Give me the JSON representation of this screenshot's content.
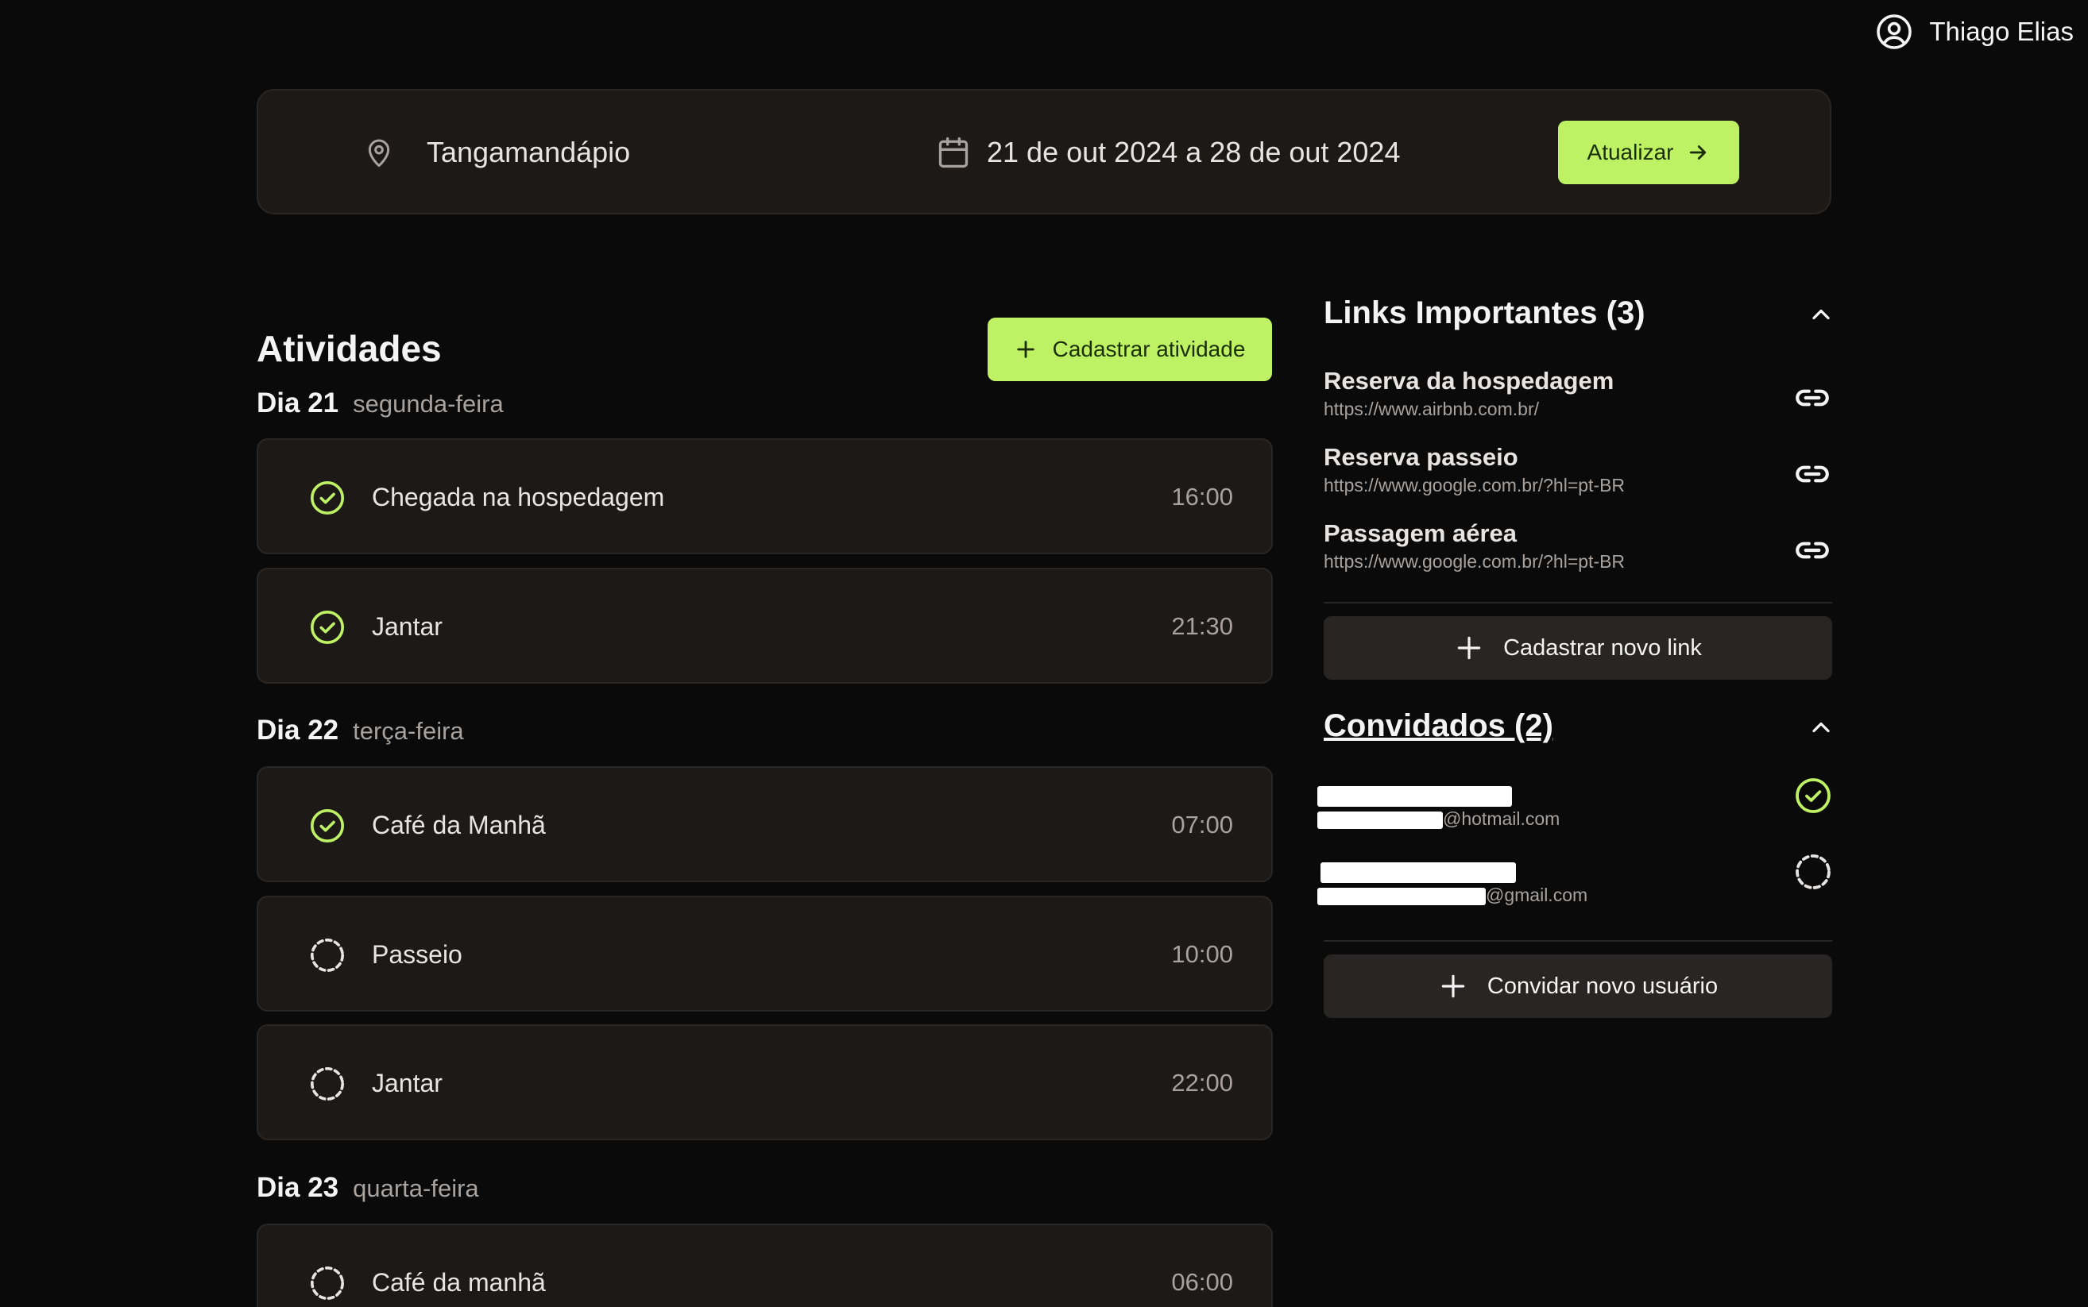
{
  "user": {
    "name": "Thiago Elias",
    "icon": "user-circle-icon"
  },
  "trip": {
    "location": "Tangamandápio",
    "dates": "21 de out 2024 a 28 de out 2024",
    "update_label": "Atualizar"
  },
  "activities": {
    "title": "Atividades",
    "add_label": "Cadastrar atividade",
    "days": [
      {
        "label": "Dia 21",
        "weekday": "segunda-feira",
        "items": [
          {
            "title": "Chegada na hospedagem",
            "time": "16:00",
            "done": true
          },
          {
            "title": "Jantar",
            "time": "21:30",
            "done": true
          }
        ]
      },
      {
        "label": "Dia 22",
        "weekday": "terça-feira",
        "items": [
          {
            "title": "Café da Manhã",
            "time": "07:00",
            "done": true
          },
          {
            "title": "Passeio",
            "time": "10:00",
            "done": false
          },
          {
            "title": "Jantar",
            "time": "22:00",
            "done": false
          }
        ]
      },
      {
        "label": "Dia 23",
        "weekday": "quarta-feira",
        "items": [
          {
            "title": "Café da manhã",
            "time": "06:00",
            "done": false
          }
        ]
      }
    ]
  },
  "links": {
    "title": "Links Importantes (3)",
    "items": [
      {
        "name": "Reserva da hospedagem",
        "url": "https://www.airbnb.com.br/"
      },
      {
        "name": "Reserva passeio",
        "url": "https://www.google.com.br/?hl=pt-BR"
      },
      {
        "name": "Passagem aérea",
        "url": "https://www.google.com.br/?hl=pt-BR"
      }
    ],
    "add_label": "Cadastrar novo link"
  },
  "guests": {
    "title": "Convidados (2)",
    "items": [
      {
        "email_suffix": "@hotmail.com",
        "confirmed": true
      },
      {
        "email_suffix": "@gmail.com",
        "confirmed": false
      }
    ],
    "invite_label": "Convidar novo usuário"
  },
  "colors": {
    "accent": "#bef264",
    "background": "#0a0a0a",
    "card": "#1c1917",
    "muted": "#a8a29e"
  }
}
